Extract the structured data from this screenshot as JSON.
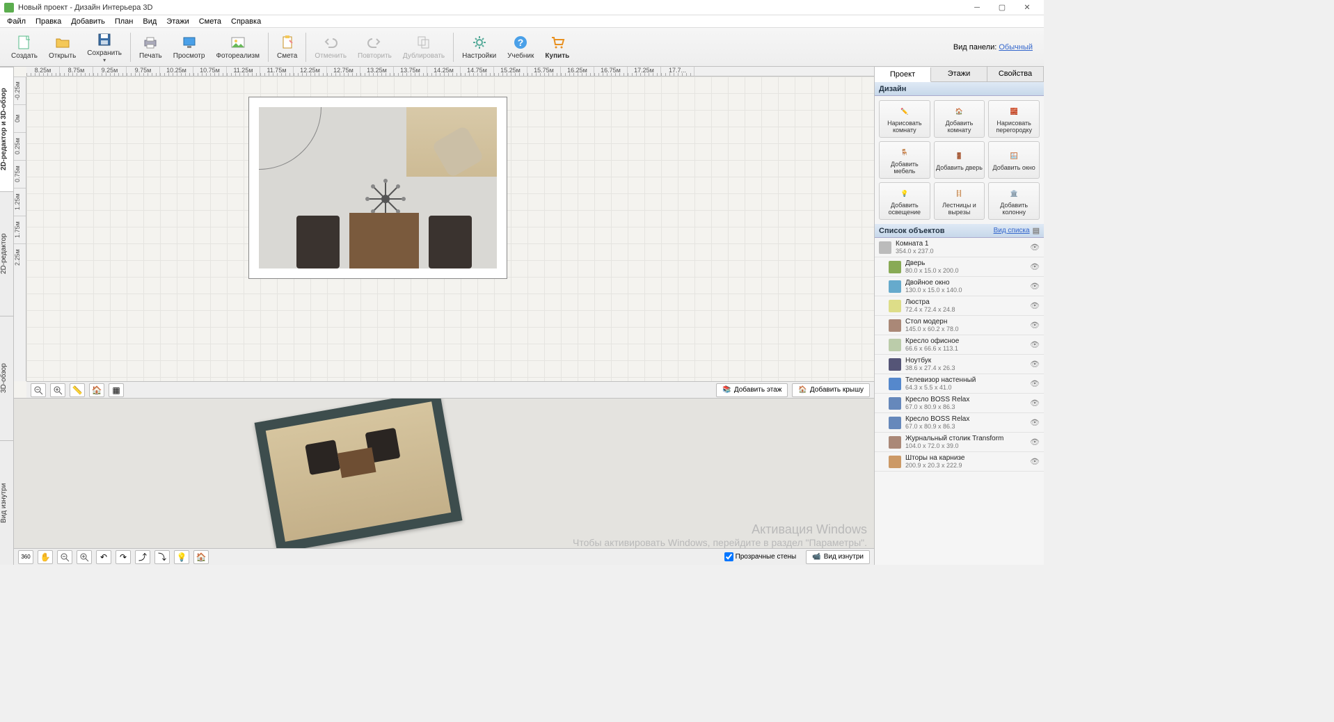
{
  "window": {
    "title": "Новый проект - Дизайн Интерьера 3D"
  },
  "menubar": [
    "Файл",
    "Правка",
    "Добавить",
    "План",
    "Вид",
    "Этажи",
    "Смета",
    "Справка"
  ],
  "toolbar": {
    "create": "Создать",
    "open": "Открыть",
    "save": "Сохранить",
    "print": "Печать",
    "view": "Просмотр",
    "photorealism": "Фотореализм",
    "estimate": "Смета",
    "undo": "Отменить",
    "redo": "Повторить",
    "duplicate": "Дублировать",
    "settings": "Настройки",
    "tutorial": "Учебник",
    "buy": "Купить",
    "panel_mode_label": "Вид панели:",
    "panel_mode_value": "Обычный"
  },
  "vtabs": [
    "2D-редактор и 3D-обзор",
    "2D-редактор",
    "3D-обзор",
    "Вид изнутри"
  ],
  "hruler": [
    "8.25м",
    "8.75м",
    "9.25м",
    "9.75м",
    "10.25м",
    "10.75м",
    "11.25м",
    "11.75м",
    "12.25м",
    "12.75м",
    "13.25м",
    "13.75м",
    "14.25м",
    "14.75м",
    "15.25м",
    "15.75м",
    "16.25м",
    "16.75м",
    "17.25м",
    "17.7..."
  ],
  "vruler": [
    "-0.25м",
    "0м",
    "0.25м",
    "0.75м",
    "1.25м",
    "1.75м",
    "2.25м"
  ],
  "bottom2d": {
    "add_floor": "Добавить этаж",
    "add_roof": "Добавить крышу"
  },
  "bottom3d": {
    "transparent_walls": "Прозрачные стены",
    "inside_view": "Вид изнутри"
  },
  "watermark": {
    "title": "Активация Windows",
    "sub": "Чтобы активировать Windows, перейдите в раздел \"Параметры\"."
  },
  "rtabs": [
    "Проект",
    "Этажи",
    "Свойства"
  ],
  "design": {
    "header": "Дизайн",
    "cards": [
      "Нарисовать комнату",
      "Добавить комнату",
      "Нарисовать перегородку",
      "Добавить мебель",
      "Добавить дверь",
      "Добавить окно",
      "Добавить освещение",
      "Лестницы и вырезы",
      "Добавить колонну"
    ]
  },
  "objects": {
    "header": "Список объектов",
    "view_link": "Вид списка",
    "items": [
      {
        "name": "Комната 1",
        "dim": "354.0 x 237.0",
        "indent": 0
      },
      {
        "name": "Дверь",
        "dim": "80.0 x 15.0 x 200.0",
        "indent": 1
      },
      {
        "name": "Двойное окно",
        "dim": "130.0 x 15.0 x 140.0",
        "indent": 1
      },
      {
        "name": "Люстра",
        "dim": "72.4 x 72.4 x 24.8",
        "indent": 1
      },
      {
        "name": "Стол модерн",
        "dim": "145.0 x 60.2 x 78.0",
        "indent": 1
      },
      {
        "name": "Кресло офисное",
        "dim": "66.6 x 66.6 x 113.1",
        "indent": 1
      },
      {
        "name": "Ноутбук",
        "dim": "38.6 x 27.4 x 26.3",
        "indent": 1
      },
      {
        "name": "Телевизор настенный",
        "dim": "64.3 x 5.5 x 41.0",
        "indent": 1
      },
      {
        "name": "Кресло BOSS Relax",
        "dim": "67.0 x 80.9 x 86.3",
        "indent": 1
      },
      {
        "name": "Кресло BOSS Relax",
        "dim": "67.0 x 80.9 x 86.3",
        "indent": 1
      },
      {
        "name": "Журнальный столик Transform",
        "dim": "104.0 x 72.0 x 39.0",
        "indent": 1
      },
      {
        "name": "Шторы на карнизе",
        "dim": "200.9 x 20.3 x 222.9",
        "indent": 1
      }
    ]
  }
}
